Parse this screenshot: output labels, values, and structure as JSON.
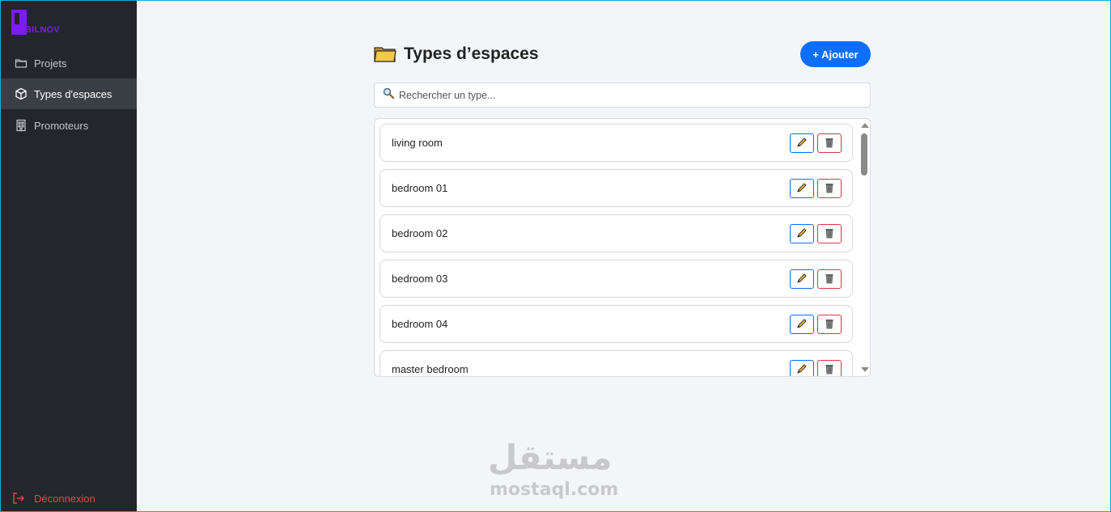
{
  "app": {
    "logo_text": "BILNOV",
    "brand_color": "#7c1cf0"
  },
  "sidebar": {
    "items": [
      {
        "label": "Projets",
        "icon": "folder-icon",
        "active": false
      },
      {
        "label": "Types d'espaces",
        "icon": "cube-icon",
        "active": true
      },
      {
        "label": "Promoteurs",
        "icon": "building-icon",
        "active": false
      }
    ],
    "logout_label": "Déconnexion"
  },
  "header": {
    "title": "Types d’espaces",
    "title_icon": "folder-emoji-icon",
    "add_label": "+ Ajouter"
  },
  "search": {
    "placeholder": "Rechercher un type...",
    "icon": "magnifier-icon"
  },
  "types": [
    {
      "name": "living room"
    },
    {
      "name": "bedroom 01"
    },
    {
      "name": "bedroom 02"
    },
    {
      "name": "bedroom 03"
    },
    {
      "name": "bedroom 04"
    },
    {
      "name": "master bedroom"
    }
  ],
  "watermark": {
    "arabic": "مستقل",
    "latin": "mostaql.com"
  },
  "colors": {
    "primary": "#0d6efd",
    "danger": "#dc3545",
    "sidebar_bg": "#23262b",
    "logout": "#e4484d"
  }
}
